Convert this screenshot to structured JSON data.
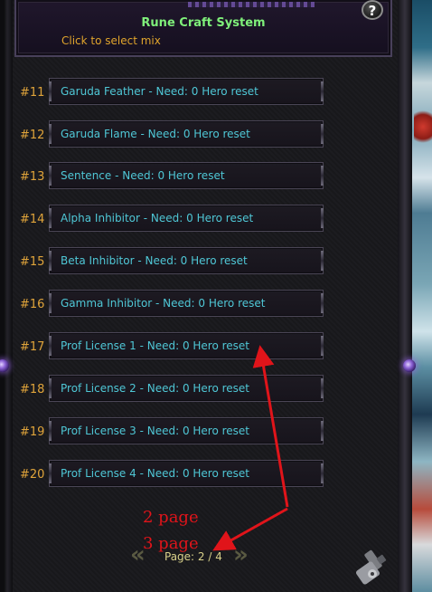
{
  "header": {
    "title": "Rune Craft System",
    "subtitle": "Click to select mix",
    "help_label": "?"
  },
  "items": [
    {
      "num": "#11",
      "label": "Garuda Feather - Need: 0 Hero reset"
    },
    {
      "num": "#12",
      "label": "Garuda Flame - Need: 0 Hero reset"
    },
    {
      "num": "#13",
      "label": "Sentence - Need: 0 Hero reset"
    },
    {
      "num": "#14",
      "label": "Alpha Inhibitor - Need: 0 Hero reset"
    },
    {
      "num": "#15",
      "label": "Beta Inhibitor - Need: 0 Hero reset"
    },
    {
      "num": "#16",
      "label": "Gamma Inhibitor - Need: 0 Hero reset"
    },
    {
      "num": "#17",
      "label": "Prof License 1 - Need: 0 Hero reset"
    },
    {
      "num": "#18",
      "label": "Prof License 2 - Need: 0 Hero reset"
    },
    {
      "num": "#19",
      "label": "Prof License 3 - Need: 0 Hero reset"
    },
    {
      "num": "#20",
      "label": "Prof License 4 - Need: 0 Hero reset"
    }
  ],
  "pager": {
    "label": "Page: 2 / 4",
    "prev_icon": "double-chevron-left-icon",
    "next_icon": "double-chevron-right-icon"
  },
  "annotations": {
    "line1": "2 page",
    "line2": "3 page"
  },
  "colors": {
    "title": "#7ff07a",
    "subtitle": "#e0a42c",
    "item_text": "#4fc7d6",
    "item_number": "#e0a43a",
    "annotation": "#e0141a"
  },
  "icons": {
    "tool": "wrench-tool-icon",
    "side_gem": "gem-icon"
  }
}
